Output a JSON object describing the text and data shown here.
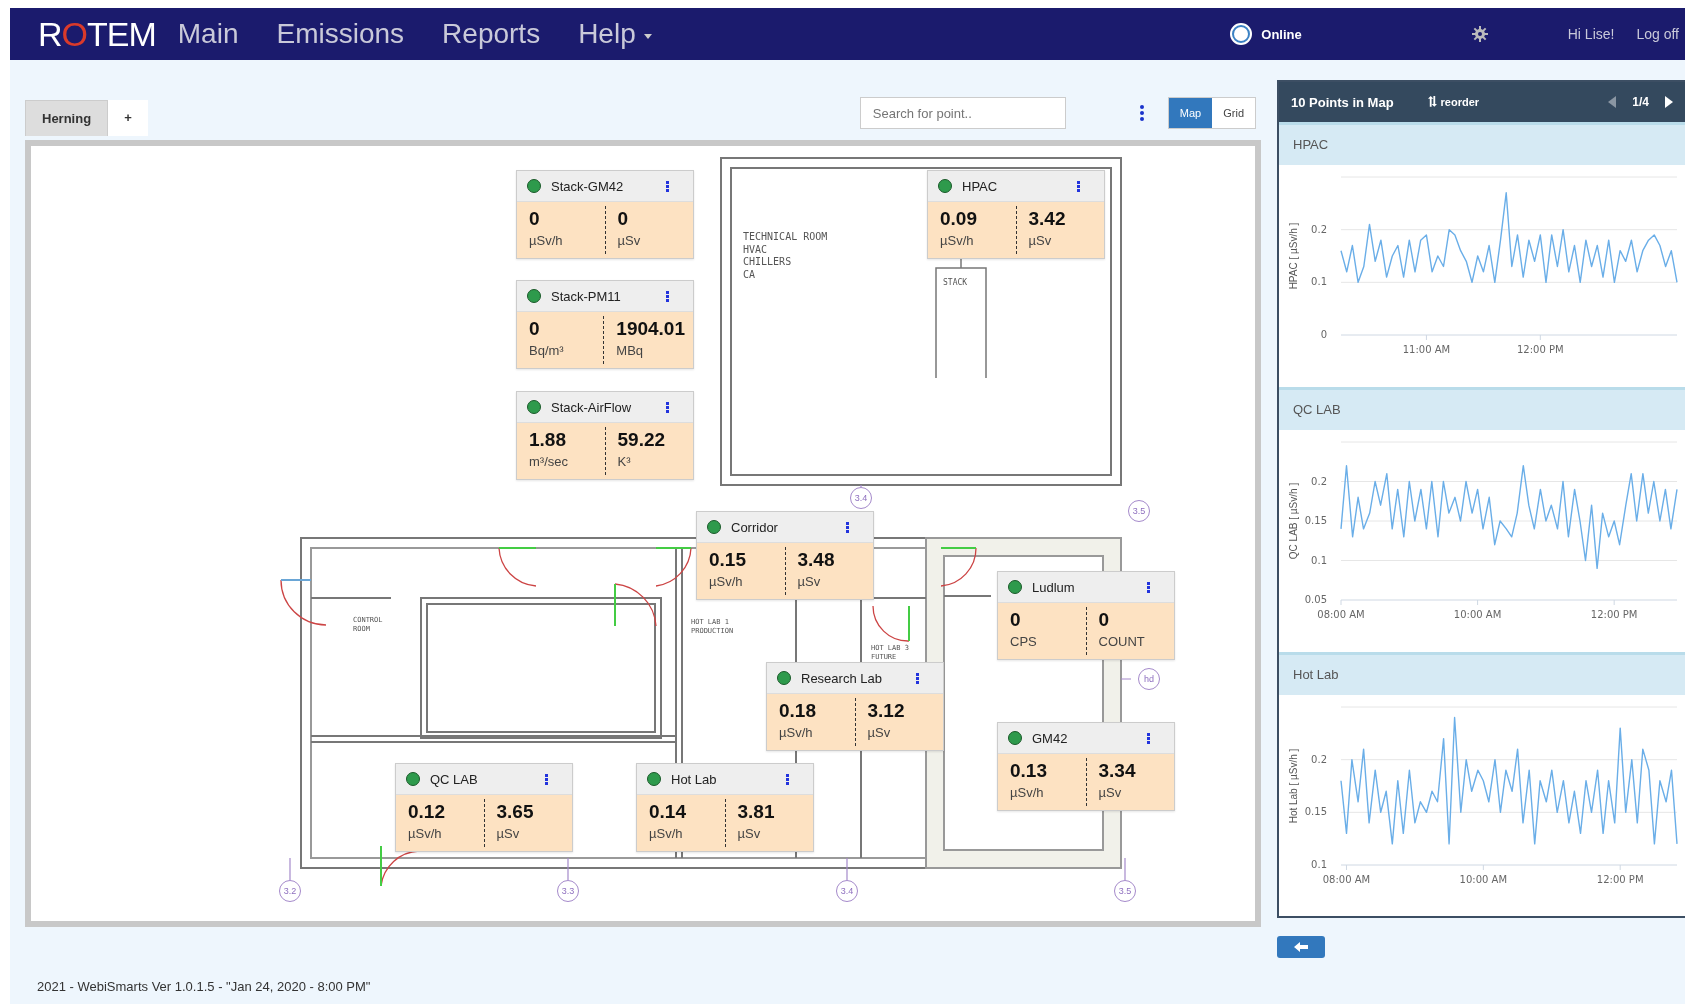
{
  "nav": {
    "logo": [
      "R",
      "O",
      "TEM"
    ],
    "menu": [
      {
        "label": "Main",
        "dropdown": false
      },
      {
        "label": "Emissions",
        "dropdown": false
      },
      {
        "label": "Reports",
        "dropdown": false
      },
      {
        "label": "Help",
        "dropdown": true
      }
    ],
    "status": {
      "label": "Online",
      "on": true
    },
    "greeting": "Hi Lise!",
    "logout": "Log off"
  },
  "tabs": [
    {
      "label": "Herning",
      "selected": true
    },
    {
      "label": "+",
      "selected": false
    }
  ],
  "search": {
    "placeholder": "Search for point.."
  },
  "view_toggle": [
    {
      "label": "Map",
      "selected": true
    },
    {
      "label": "Grid",
      "selected": false
    }
  ],
  "map": {
    "points": [
      {
        "name": "Stack-GM42",
        "color": "#2e9a4c",
        "readings": [
          {
            "value": "0",
            "unit": "µSv/h"
          },
          {
            "value": "0",
            "unit": "µSv"
          }
        ]
      },
      {
        "name": "Stack-PM11",
        "color": "#2e9a4c",
        "readings": [
          {
            "value": "0",
            "unit": "Bq/m³"
          },
          {
            "value": "1904.01",
            "unit": "MBq"
          }
        ]
      },
      {
        "name": "Stack-AirFlow",
        "color": "#2e9a4c",
        "readings": [
          {
            "value": "1.88",
            "unit": "m³/sec"
          },
          {
            "value": "59.22",
            "unit": "K³"
          }
        ]
      },
      {
        "name": "HPAC",
        "color": "#2e9a4c",
        "readings": [
          {
            "value": "0.09",
            "unit": "µSv/h"
          },
          {
            "value": "3.42",
            "unit": "µSv"
          }
        ]
      },
      {
        "name": "Corridor",
        "color": "#2e9a4c",
        "readings": [
          {
            "value": "0.15",
            "unit": "µSv/h"
          },
          {
            "value": "3.48",
            "unit": "µSv"
          }
        ]
      },
      {
        "name": "Ludlum",
        "color": "#2e9a4c",
        "readings": [
          {
            "value": "0",
            "unit": "CPS"
          },
          {
            "value": "0",
            "unit": "COUNT"
          }
        ]
      },
      {
        "name": "Research Lab",
        "color": "#2e9a4c",
        "readings": [
          {
            "value": "0.18",
            "unit": "µSv/h"
          },
          {
            "value": "3.12",
            "unit": "µSv"
          }
        ]
      },
      {
        "name": "GM42",
        "color": "#2e9a4c",
        "readings": [
          {
            "value": "0.13",
            "unit": "µSv/h"
          },
          {
            "value": "3.34",
            "unit": "µSv"
          }
        ]
      },
      {
        "name": "QC LAB",
        "color": "#2e9a4c",
        "readings": [
          {
            "value": "0.12",
            "unit": "µSv/h"
          },
          {
            "value": "3.65",
            "unit": "µSv"
          }
        ]
      },
      {
        "name": "Hot Lab",
        "color": "#2e9a4c",
        "readings": [
          {
            "value": "0.14",
            "unit": "µSv/h"
          },
          {
            "value": "3.81",
            "unit": "µSv"
          }
        ]
      }
    ],
    "labels": [
      "TECHNICAL ROOM\nHVAC\nCHILLERS\nCA",
      "STACK",
      "CONTROL\nROOM",
      "HOT LAB 1\nPRODUCTION",
      "HOT LAB 3\nFUTURE"
    ],
    "markers": [
      "3.4",
      "3.5",
      "hd",
      "3.2",
      "3.3",
      "3.4",
      "3.5"
    ]
  },
  "panel": {
    "title": "10 Points in Map",
    "reorder": "reorder",
    "page": "1/4",
    "prev_disabled": true,
    "next_disabled": false,
    "charts": [
      {
        "title": "HPAC",
        "chart_data": {
          "type": "line",
          "grid": true,
          "x": [
            10.25,
            10.3,
            10.35,
            10.4,
            10.45,
            10.5,
            10.55,
            10.6,
            10.65,
            10.7,
            10.75,
            10.8,
            10.85,
            10.9,
            10.95,
            11,
            11.05,
            11.1,
            11.15,
            11.2,
            11.25,
            11.3,
            11.35,
            11.4,
            11.45,
            11.5,
            11.55,
            11.6,
            11.65,
            11.7,
            11.75,
            11.8,
            11.85,
            11.9,
            11.95,
            12,
            12.05,
            12.1,
            12.15,
            12.2,
            12.25,
            12.3,
            12.35,
            12.4,
            12.45,
            12.5,
            12.55,
            12.6,
            12.65,
            12.7,
            12.75,
            12.8,
            12.85,
            12.9,
            12.95,
            13,
            13.05,
            13.1,
            13.15,
            13.2
          ],
          "ylabel": "HPAC [ µSv/h ]",
          "xlim": [
            10.25,
            13.2
          ],
          "ylim": [
            0,
            0.3
          ],
          "yticks": [
            0,
            0.1,
            0.2
          ],
          "xticks": [
            {
              "value": 11,
              "label": "11:00 AM"
            },
            {
              "value": 12,
              "label": "12:00 PM"
            }
          ],
          "series": [
            {
              "color": "#6aaee8",
              "values": [
                0.16,
                0.12,
                0.17,
                0.1,
                0.13,
                0.21,
                0.14,
                0.18,
                0.11,
                0.15,
                0.17,
                0.11,
                0.18,
                0.12,
                0.18,
                0.19,
                0.12,
                0.15,
                0.13,
                0.2,
                0.19,
                0.16,
                0.14,
                0.1,
                0.15,
                0.12,
                0.17,
                0.1,
                0.18,
                0.27,
                0.13,
                0.19,
                0.11,
                0.18,
                0.14,
                0.19,
                0.1,
                0.19,
                0.13,
                0.2,
                0.12,
                0.17,
                0.1,
                0.18,
                0.13,
                0.17,
                0.11,
                0.18,
                0.1,
                0.16,
                0.14,
                0.18,
                0.12,
                0.16,
                0.18,
                0.19,
                0.17,
                0.13,
                0.16,
                0.1
              ]
            }
          ]
        }
      },
      {
        "title": "QC LAB",
        "chart_data": {
          "type": "line",
          "grid": true,
          "x": [
            8,
            8.08,
            8.17,
            8.25,
            8.33,
            8.42,
            8.5,
            8.58,
            8.67,
            8.75,
            8.83,
            8.92,
            9,
            9.08,
            9.17,
            9.25,
            9.33,
            9.42,
            9.5,
            9.58,
            9.67,
            9.75,
            9.83,
            9.92,
            10,
            10.08,
            10.17,
            10.25,
            10.33,
            10.42,
            10.5,
            10.58,
            10.67,
            10.75,
            10.83,
            10.92,
            11,
            11.08,
            11.17,
            11.25,
            11.33,
            11.42,
            11.5,
            11.58,
            11.67,
            11.75,
            11.83,
            11.92,
            12,
            12.08,
            12.17,
            12.25,
            12.33,
            12.42,
            12.5,
            12.58,
            12.67,
            12.75,
            12.83,
            12.92
          ],
          "ylabel": "QC LAB [ µSv/h ]",
          "xlim": [
            8,
            12.92
          ],
          "ylim": [
            0.05,
            0.25
          ],
          "yticks": [
            0.05,
            0.1,
            0.15,
            0.2
          ],
          "xticks": [
            {
              "value": 8,
              "label": "08:00 AM"
            },
            {
              "value": 10,
              "label": "10:00 AM"
            },
            {
              "value": 12,
              "label": "12:00 PM"
            }
          ],
          "series": [
            {
              "color": "#6aaee8",
              "values": [
                0.14,
                0.22,
                0.13,
                0.18,
                0.14,
                0.16,
                0.2,
                0.17,
                0.21,
                0.14,
                0.19,
                0.13,
                0.2,
                0.15,
                0.19,
                0.14,
                0.2,
                0.13,
                0.2,
                0.16,
                0.18,
                0.15,
                0.2,
                0.16,
                0.19,
                0.14,
                0.18,
                0.12,
                0.15,
                0.14,
                0.13,
                0.16,
                0.22,
                0.17,
                0.14,
                0.19,
                0.15,
                0.17,
                0.14,
                0.2,
                0.13,
                0.19,
                0.15,
                0.1,
                0.17,
                0.09,
                0.16,
                0.13,
                0.15,
                0.12,
                0.17,
                0.21,
                0.15,
                0.21,
                0.16,
                0.2,
                0.15,
                0.19,
                0.14,
                0.19
              ]
            }
          ]
        }
      },
      {
        "title": "Hot Lab",
        "chart_data": {
          "type": "line",
          "grid": true,
          "x": [
            7.92,
            8,
            8.08,
            8.17,
            8.25,
            8.33,
            8.42,
            8.5,
            8.58,
            8.67,
            8.75,
            8.83,
            8.92,
            9,
            9.08,
            9.17,
            9.25,
            9.33,
            9.42,
            9.5,
            9.58,
            9.67,
            9.75,
            9.83,
            9.92,
            10,
            10.08,
            10.17,
            10.25,
            10.33,
            10.42,
            10.5,
            10.58,
            10.67,
            10.75,
            10.83,
            10.92,
            11,
            11.08,
            11.17,
            11.25,
            11.33,
            11.42,
            11.5,
            11.58,
            11.67,
            11.75,
            11.83,
            11.92,
            12,
            12.08,
            12.17,
            12.25,
            12.33,
            12.42,
            12.5,
            12.58,
            12.67,
            12.75,
            12.83
          ],
          "ylabel": "Hot Lab [ µSv/h ]",
          "xlim": [
            7.92,
            12.83
          ],
          "ylim": [
            0.1,
            0.25
          ],
          "yticks": [
            0.1,
            0.15,
            0.2
          ],
          "xticks": [
            {
              "value": 8,
              "label": "08:00 AM"
            },
            {
              "value": 10,
              "label": "10:00 AM"
            },
            {
              "value": 12,
              "label": "12:00 PM"
            }
          ],
          "series": [
            {
              "color": "#6aaee8",
              "values": [
                0.18,
                0.13,
                0.2,
                0.16,
                0.21,
                0.14,
                0.19,
                0.15,
                0.17,
                0.12,
                0.18,
                0.13,
                0.19,
                0.14,
                0.16,
                0.15,
                0.17,
                0.16,
                0.22,
                0.12,
                0.24,
                0.15,
                0.2,
                0.17,
                0.19,
                0.18,
                0.16,
                0.2,
                0.15,
                0.19,
                0.17,
                0.21,
                0.14,
                0.19,
                0.12,
                0.18,
                0.16,
                0.19,
                0.15,
                0.18,
                0.14,
                0.17,
                0.13,
                0.18,
                0.15,
                0.19,
                0.13,
                0.18,
                0.14,
                0.23,
                0.15,
                0.2,
                0.14,
                0.21,
                0.19,
                0.12,
                0.18,
                0.16,
                0.19,
                0.12
              ]
            }
          ]
        }
      }
    ]
  },
  "footer": "2021 - WebiSmarts Ver 1.0.1.5 - \"Jan 24, 2020 - 8:00 PM\""
}
